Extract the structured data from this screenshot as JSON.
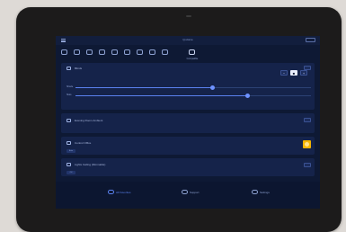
{
  "app": {
    "title": "Q-Home"
  },
  "rooms": {
    "icons": [
      "sofa-icon",
      "bed-icon",
      "bath-icon",
      "kitchen-icon",
      "dining-icon",
      "bedroom-icon",
      "lamp-icon",
      "desk-icon",
      "garage-icon",
      "terrace-icon"
    ],
    "selected_index": 9,
    "selected_caption": "Compatible"
  },
  "lamp_card": {
    "title": "Blinds",
    "toggle_on": false,
    "sliders": [
      {
        "label": "Shade",
        "level": 0.58
      },
      {
        "label": "Slats",
        "level": 0.73
      }
    ],
    "stepper": {
      "minus": "−",
      "center": "■",
      "plus": "+"
    }
  },
  "scene_card": {
    "title": "Evening Room Ambient"
  },
  "ac_card": {
    "title": "Control Office",
    "status_color": "#f4b400",
    "pill": "Auto"
  },
  "light_card": {
    "title": "Lights Ceiling (Dimmable)",
    "pill": "Off"
  },
  "bottom_nav": [
    {
      "label": "All Favorites",
      "icon": "star-icon",
      "active": true
    },
    {
      "label": "Support",
      "icon": "support-icon",
      "active": false
    },
    {
      "label": "Settings",
      "icon": "gear-icon",
      "active": false
    }
  ],
  "colors": {
    "accent": "#5b82f0",
    "screen_bg": "#0e1934",
    "card_bg": "#15234a",
    "status": "#f4b400"
  }
}
